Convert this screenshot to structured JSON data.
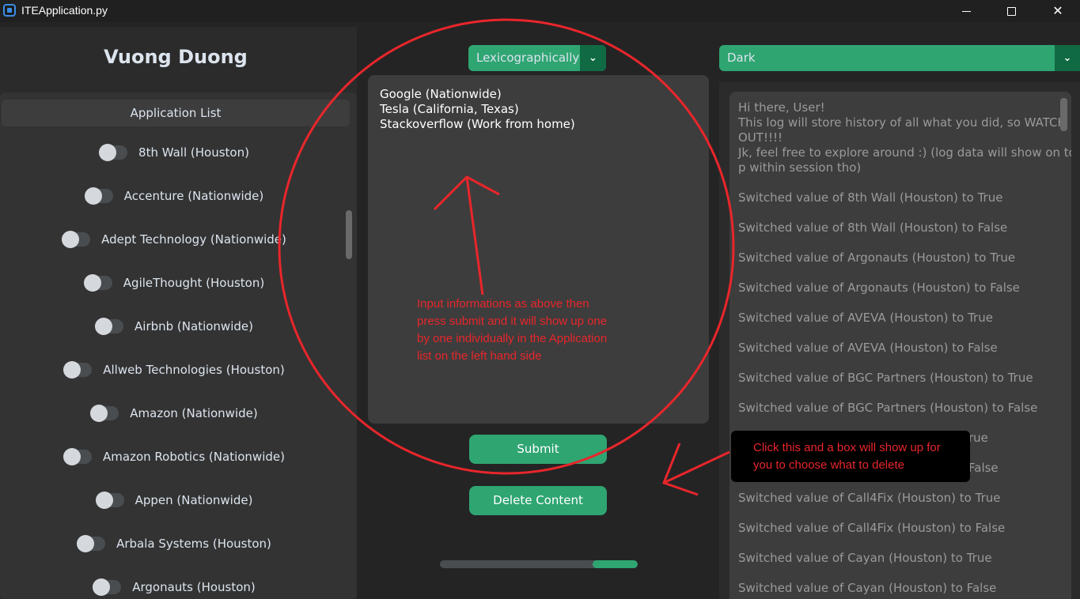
{
  "window": {
    "title": "ITEApplication.py"
  },
  "sidebar": {
    "profile_name": "Vuong Duong",
    "list_header": "Application List",
    "items": [
      {
        "label": "8th Wall (Houston)"
      },
      {
        "label": "Accenture (Nationwide)"
      },
      {
        "label": "Adept Technology (Nationwide)"
      },
      {
        "label": "AgileThought (Houston)"
      },
      {
        "label": "Airbnb (Nationwide)"
      },
      {
        "label": "Allweb Technologies (Houston)"
      },
      {
        "label": "Amazon (Nationwide)"
      },
      {
        "label": "Amazon Robotics (Nationwide)"
      },
      {
        "label": "Appen (Nationwide)"
      },
      {
        "label": "Arbala Systems (Houston)"
      },
      {
        "label": "Argonauts (Houston)"
      }
    ]
  },
  "middle": {
    "sort_option": "Lexicographically",
    "textbox_lines": [
      "Google (Nationwide)",
      "Tesla (California, Texas)",
      "Stackoverflow (Work from home)"
    ],
    "submit_label": "Submit",
    "delete_label": "Delete Content",
    "progress_fraction": 0.23
  },
  "right": {
    "theme_option": "Dark",
    "log_lines": [
      "Hi there, User!",
      "This log will store history of all what you did, so WATCH",
      "OUT!!!!",
      "Jk, feel free to explore around :) (log data will show on to",
      "p within session tho)",
      "Switched value of 8th Wall (Houston) to True",
      "Switched value of 8th Wall (Houston) to False",
      "Switched value of Argonauts (Houston) to True",
      "Switched value of Argonauts (Houston) to False",
      "Switched value of AVEVA (Houston) to True",
      "Switched value of AVEVA (Houston) to False",
      "Switched value of BGC Partners (Houston) to True",
      "Switched value of BGC Partners (Houston) to False",
      "Switched value of Call4Fix (Houston) to True",
      "Switched value of Call4Fix (Houston) to False",
      "Switched value of Cayan (Houston) to True",
      "Switched value of Cayan (Houston) to False"
    ],
    "log_lines_partial": [
      "rue",
      "False"
    ]
  },
  "annotations": {
    "left_note": "Input informations as above then press submit and it will show up one by one individually in the Application list on the left hand side",
    "right_note": "Click this and a box will show up for you to choose what to delete",
    "color": "#e8262b"
  },
  "colors": {
    "accent": "#2fa572",
    "accent_dark": "#106a43",
    "background": "#242424"
  }
}
